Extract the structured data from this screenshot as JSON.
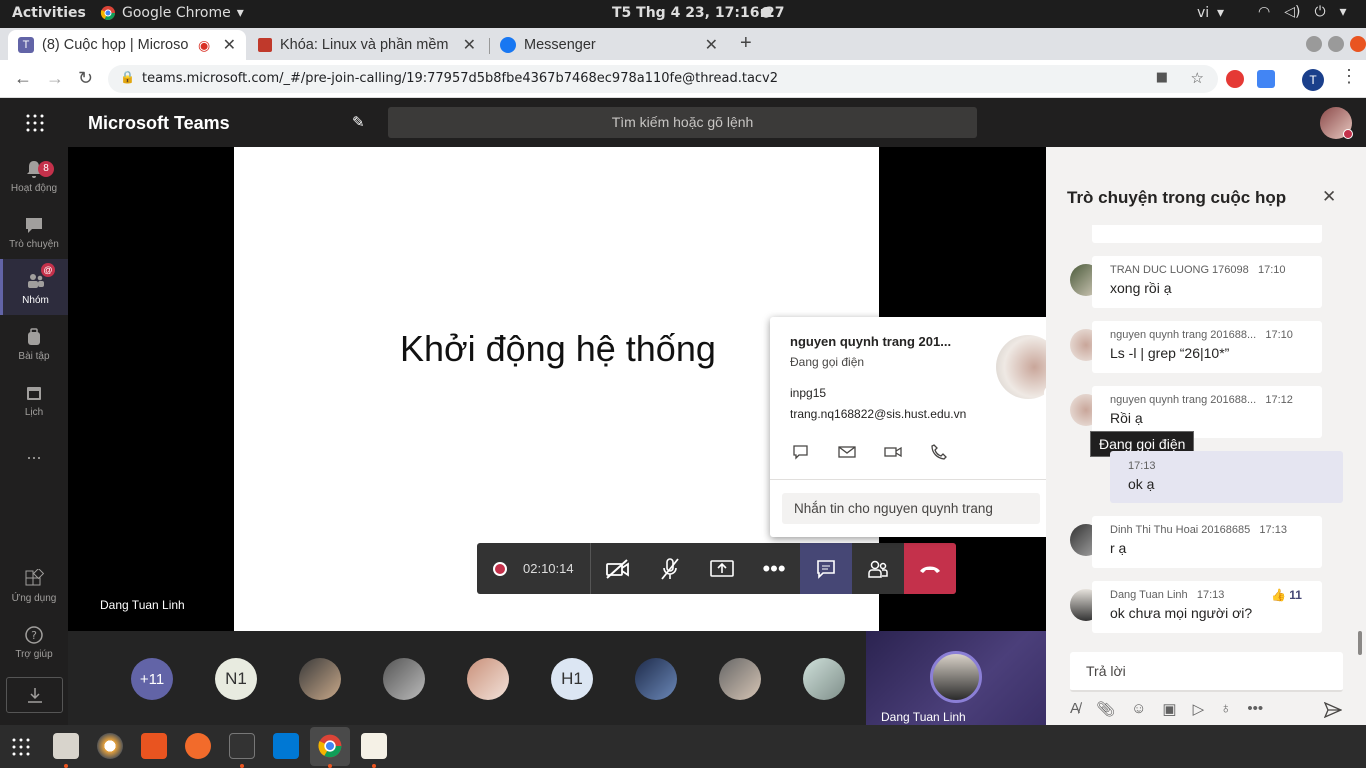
{
  "os_bar": {
    "activities": "Activities",
    "app_name": "Google Chrome",
    "clock": "T5 Thg 4 23, 17:16:27",
    "lang": "vi"
  },
  "tabs": [
    {
      "label": "(8) Cuộc họp | Microso"
    },
    {
      "label": "Khóa: Linux và phần mềm"
    },
    {
      "label": "Messenger"
    }
  ],
  "address": {
    "url": "teams.microsoft.com/_#/pre-join-calling/19:77957d5b8fbe4367b7468ec978a110fe@thread.tacv2",
    "profile_initial": "T"
  },
  "teams": {
    "title": "Microsoft Teams",
    "search_placeholder": "Tìm kiếm hoặc gõ lệnh"
  },
  "rail": [
    {
      "label": "Hoạt động",
      "badge": "8"
    },
    {
      "label": "Trò chuyện"
    },
    {
      "label": "Nhóm",
      "badge": "@"
    },
    {
      "label": "Bài tập"
    },
    {
      "label": "Lịch"
    },
    {
      "label": "..."
    },
    {
      "label": "Ứng dụng"
    },
    {
      "label": "Trợ giúp"
    }
  ],
  "stage": {
    "slide_text": "Khởi động hệ thống",
    "presenter_name": "Dang Tuan Linh"
  },
  "participants": [
    {
      "label": "+11",
      "color": "#6264a7"
    },
    {
      "label": "N1",
      "color": "#e8ebe0"
    },
    {
      "label": ""
    },
    {
      "label": ""
    },
    {
      "label": ""
    },
    {
      "label": "H1",
      "color": "#dce6f3"
    },
    {
      "label": ""
    },
    {
      "label": ""
    },
    {
      "label": ""
    }
  ],
  "self_view": {
    "name": "Dang Tuan Linh"
  },
  "controls": {
    "timer": "02:10:14",
    "hangup_color": "#c4314b"
  },
  "contact_card": {
    "name": "nguyen quynh trang 201...",
    "status": "Đang gọi điện",
    "info1": "inpg15",
    "email": "trang.nq168822@sis.hust.edu.vn",
    "message_placeholder": "Nhắn tin cho nguyen quynh trang"
  },
  "chat": {
    "title": "Trò chuyện trong cuộc họp",
    "tooltip": "Đang gọi điện",
    "messages": [
      {
        "author": "TRAN DUC LUONG 176098",
        "time": "17:10",
        "text": "xong rồi ạ"
      },
      {
        "author": "nguyen quynh trang 201688...",
        "time": "17:10",
        "text": "Ls -l | grep “26|10*”"
      },
      {
        "author": "nguyen quynh trang 201688...",
        "time": "17:12",
        "text": "Rồi ạ"
      },
      {
        "author": "",
        "time": "17:13",
        "text": "ok ạ"
      },
      {
        "author": "Dinh Thi Thu Hoai 20168685",
        "time": "17:13",
        "text": "r ạ"
      },
      {
        "author": "Dang Tuan Linh",
        "time": "17:13",
        "text": "ok chưa mọi người  ơi?",
        "reaction": "11"
      }
    ],
    "reply_placeholder": "Trả lời"
  }
}
